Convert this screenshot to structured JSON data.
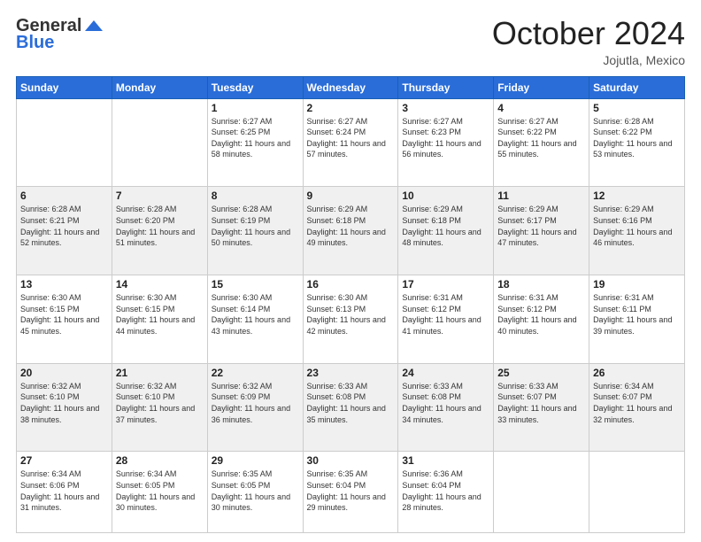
{
  "header": {
    "logo_line1": "General",
    "logo_line2": "Blue",
    "month": "October 2024",
    "location": "Jojutla, Mexico"
  },
  "days_of_week": [
    "Sunday",
    "Monday",
    "Tuesday",
    "Wednesday",
    "Thursday",
    "Friday",
    "Saturday"
  ],
  "weeks": [
    [
      {
        "day": "",
        "sunrise": "",
        "sunset": "",
        "daylight": ""
      },
      {
        "day": "",
        "sunrise": "",
        "sunset": "",
        "daylight": ""
      },
      {
        "day": "1",
        "sunrise": "Sunrise: 6:27 AM",
        "sunset": "Sunset: 6:25 PM",
        "daylight": "Daylight: 11 hours and 58 minutes."
      },
      {
        "day": "2",
        "sunrise": "Sunrise: 6:27 AM",
        "sunset": "Sunset: 6:24 PM",
        "daylight": "Daylight: 11 hours and 57 minutes."
      },
      {
        "day": "3",
        "sunrise": "Sunrise: 6:27 AM",
        "sunset": "Sunset: 6:23 PM",
        "daylight": "Daylight: 11 hours and 56 minutes."
      },
      {
        "day": "4",
        "sunrise": "Sunrise: 6:27 AM",
        "sunset": "Sunset: 6:22 PM",
        "daylight": "Daylight: 11 hours and 55 minutes."
      },
      {
        "day": "5",
        "sunrise": "Sunrise: 6:28 AM",
        "sunset": "Sunset: 6:22 PM",
        "daylight": "Daylight: 11 hours and 53 minutes."
      }
    ],
    [
      {
        "day": "6",
        "sunrise": "Sunrise: 6:28 AM",
        "sunset": "Sunset: 6:21 PM",
        "daylight": "Daylight: 11 hours and 52 minutes."
      },
      {
        "day": "7",
        "sunrise": "Sunrise: 6:28 AM",
        "sunset": "Sunset: 6:20 PM",
        "daylight": "Daylight: 11 hours and 51 minutes."
      },
      {
        "day": "8",
        "sunrise": "Sunrise: 6:28 AM",
        "sunset": "Sunset: 6:19 PM",
        "daylight": "Daylight: 11 hours and 50 minutes."
      },
      {
        "day": "9",
        "sunrise": "Sunrise: 6:29 AM",
        "sunset": "Sunset: 6:18 PM",
        "daylight": "Daylight: 11 hours and 49 minutes."
      },
      {
        "day": "10",
        "sunrise": "Sunrise: 6:29 AM",
        "sunset": "Sunset: 6:18 PM",
        "daylight": "Daylight: 11 hours and 48 minutes."
      },
      {
        "day": "11",
        "sunrise": "Sunrise: 6:29 AM",
        "sunset": "Sunset: 6:17 PM",
        "daylight": "Daylight: 11 hours and 47 minutes."
      },
      {
        "day": "12",
        "sunrise": "Sunrise: 6:29 AM",
        "sunset": "Sunset: 6:16 PM",
        "daylight": "Daylight: 11 hours and 46 minutes."
      }
    ],
    [
      {
        "day": "13",
        "sunrise": "Sunrise: 6:30 AM",
        "sunset": "Sunset: 6:15 PM",
        "daylight": "Daylight: 11 hours and 45 minutes."
      },
      {
        "day": "14",
        "sunrise": "Sunrise: 6:30 AM",
        "sunset": "Sunset: 6:15 PM",
        "daylight": "Daylight: 11 hours and 44 minutes."
      },
      {
        "day": "15",
        "sunrise": "Sunrise: 6:30 AM",
        "sunset": "Sunset: 6:14 PM",
        "daylight": "Daylight: 11 hours and 43 minutes."
      },
      {
        "day": "16",
        "sunrise": "Sunrise: 6:30 AM",
        "sunset": "Sunset: 6:13 PM",
        "daylight": "Daylight: 11 hours and 42 minutes."
      },
      {
        "day": "17",
        "sunrise": "Sunrise: 6:31 AM",
        "sunset": "Sunset: 6:12 PM",
        "daylight": "Daylight: 11 hours and 41 minutes."
      },
      {
        "day": "18",
        "sunrise": "Sunrise: 6:31 AM",
        "sunset": "Sunset: 6:12 PM",
        "daylight": "Daylight: 11 hours and 40 minutes."
      },
      {
        "day": "19",
        "sunrise": "Sunrise: 6:31 AM",
        "sunset": "Sunset: 6:11 PM",
        "daylight": "Daylight: 11 hours and 39 minutes."
      }
    ],
    [
      {
        "day": "20",
        "sunrise": "Sunrise: 6:32 AM",
        "sunset": "Sunset: 6:10 PM",
        "daylight": "Daylight: 11 hours and 38 minutes."
      },
      {
        "day": "21",
        "sunrise": "Sunrise: 6:32 AM",
        "sunset": "Sunset: 6:10 PM",
        "daylight": "Daylight: 11 hours and 37 minutes."
      },
      {
        "day": "22",
        "sunrise": "Sunrise: 6:32 AM",
        "sunset": "Sunset: 6:09 PM",
        "daylight": "Daylight: 11 hours and 36 minutes."
      },
      {
        "day": "23",
        "sunrise": "Sunrise: 6:33 AM",
        "sunset": "Sunset: 6:08 PM",
        "daylight": "Daylight: 11 hours and 35 minutes."
      },
      {
        "day": "24",
        "sunrise": "Sunrise: 6:33 AM",
        "sunset": "Sunset: 6:08 PM",
        "daylight": "Daylight: 11 hours and 34 minutes."
      },
      {
        "day": "25",
        "sunrise": "Sunrise: 6:33 AM",
        "sunset": "Sunset: 6:07 PM",
        "daylight": "Daylight: 11 hours and 33 minutes."
      },
      {
        "day": "26",
        "sunrise": "Sunrise: 6:34 AM",
        "sunset": "Sunset: 6:07 PM",
        "daylight": "Daylight: 11 hours and 32 minutes."
      }
    ],
    [
      {
        "day": "27",
        "sunrise": "Sunrise: 6:34 AM",
        "sunset": "Sunset: 6:06 PM",
        "daylight": "Daylight: 11 hours and 31 minutes."
      },
      {
        "day": "28",
        "sunrise": "Sunrise: 6:34 AM",
        "sunset": "Sunset: 6:05 PM",
        "daylight": "Daylight: 11 hours and 30 minutes."
      },
      {
        "day": "29",
        "sunrise": "Sunrise: 6:35 AM",
        "sunset": "Sunset: 6:05 PM",
        "daylight": "Daylight: 11 hours and 30 minutes."
      },
      {
        "day": "30",
        "sunrise": "Sunrise: 6:35 AM",
        "sunset": "Sunset: 6:04 PM",
        "daylight": "Daylight: 11 hours and 29 minutes."
      },
      {
        "day": "31",
        "sunrise": "Sunrise: 6:36 AM",
        "sunset": "Sunset: 6:04 PM",
        "daylight": "Daylight: 11 hours and 28 minutes."
      },
      {
        "day": "",
        "sunrise": "",
        "sunset": "",
        "daylight": ""
      },
      {
        "day": "",
        "sunrise": "",
        "sunset": "",
        "daylight": ""
      }
    ]
  ]
}
